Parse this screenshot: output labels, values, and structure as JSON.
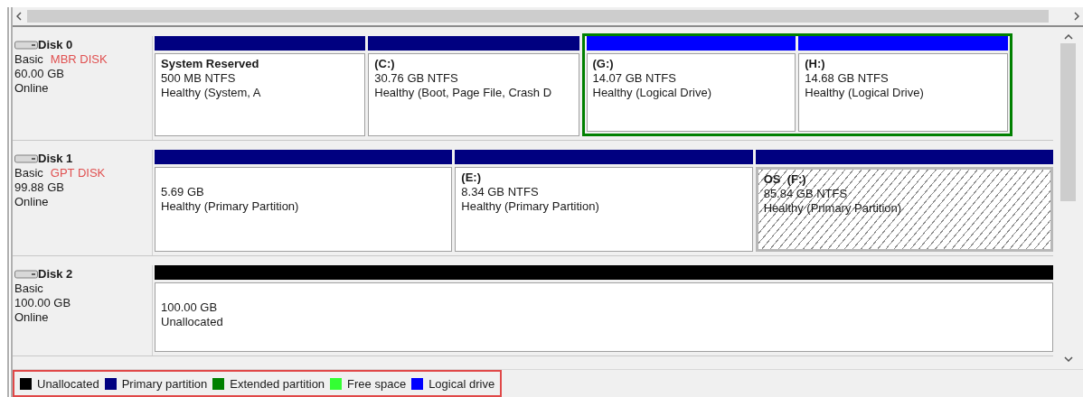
{
  "disks": [
    {
      "name": "Disk 0",
      "type": "Basic",
      "style": "MBR DISK",
      "size": "60.00 GB",
      "status": "Online",
      "partitions": [
        {
          "kind": "primary",
          "label": "System Reserved",
          "size": "500 MB NTFS",
          "health": "Healthy (System, A",
          "selected": false
        },
        {
          "kind": "primary",
          "label": "(C:)",
          "size": "30.76 GB NTFS",
          "health": "Healthy (Boot, Page File, Crash D",
          "selected": false
        },
        {
          "kind": "extended",
          "children": [
            {
              "kind": "logical",
              "label": "(G:)",
              "size": "14.07 GB NTFS",
              "health": "Healthy (Logical Drive)",
              "selected": false
            },
            {
              "kind": "logical",
              "label": "(H:)",
              "size": "14.68 GB NTFS",
              "health": "Healthy (Logical Drive)",
              "selected": false
            }
          ]
        }
      ]
    },
    {
      "name": "Disk 1",
      "type": "Basic",
      "style": "GPT DISK",
      "size": "99.88 GB",
      "status": "Online",
      "partitions": [
        {
          "kind": "primary",
          "size": "5.69 GB",
          "health": "Healthy (Primary Partition)",
          "selected": false
        },
        {
          "kind": "primary",
          "label": "(E:)",
          "size": "8.34 GB NTFS",
          "health": "Healthy (Primary Partition)",
          "selected": false
        },
        {
          "kind": "primary",
          "label": "OS  (F:)",
          "size": "85.84 GB NTFS",
          "health": "Healthy (Primary Partition)",
          "selected": true
        }
      ]
    },
    {
      "name": "Disk 2",
      "type": "Basic",
      "size": "100.00 GB",
      "status": "Online",
      "partitions": [
        {
          "kind": "unallocated",
          "size": "100.00 GB",
          "health": "Unallocated",
          "selected": false
        }
      ]
    }
  ],
  "legend": [
    {
      "label": "Unallocated",
      "color": "#000000"
    },
    {
      "label": "Primary partition",
      "color": "#000080"
    },
    {
      "label": "Extended partition",
      "color": "#008000"
    },
    {
      "label": "Free space",
      "color": "#33ff33"
    },
    {
      "label": "Logical drive",
      "color": "#0000ff"
    }
  ]
}
